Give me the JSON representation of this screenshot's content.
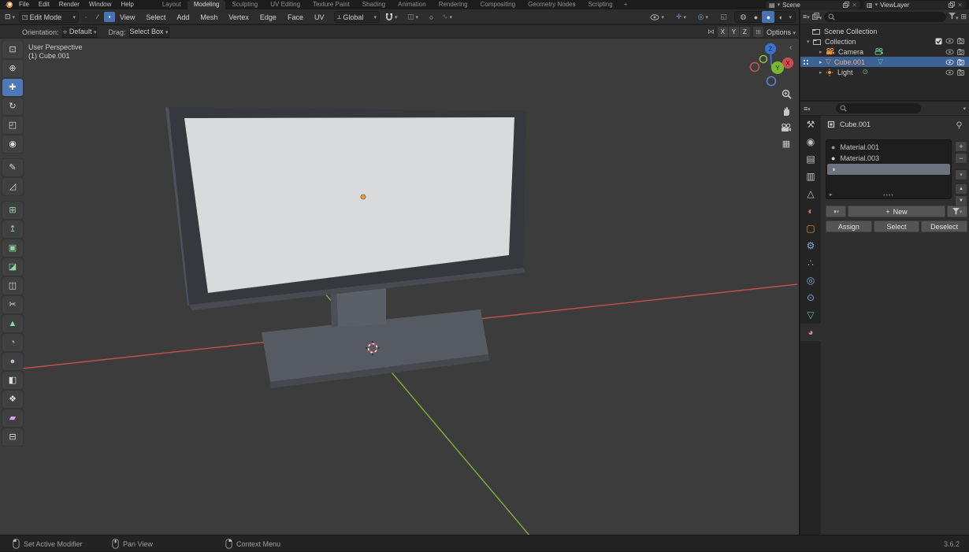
{
  "colors": {
    "selection_blue": "#4772b3",
    "active_object_text": "#f0ad6d",
    "axis_x_red": "#c0504f",
    "axis_y_green": "#7fb439",
    "gizmo_x": "#d04a55",
    "gizmo_y": "#7ab82f",
    "gizmo_z": "#3873cf",
    "screen_light": "#d9dadc",
    "origin_orange": "#ea9e43",
    "icon_green": "#63c184",
    "icon_orange": "#e8913c"
  },
  "topbar": {
    "menus": [
      {
        "name": "file",
        "label": "File"
      },
      {
        "name": "edit",
        "label": "Edit"
      },
      {
        "name": "render",
        "label": "Render"
      },
      {
        "name": "window",
        "label": "Window"
      },
      {
        "name": "help",
        "label": "Help"
      }
    ],
    "tabs": [
      {
        "name": "layout",
        "label": "Layout"
      },
      {
        "name": "modeling",
        "label": "Modeling",
        "active": true
      },
      {
        "name": "sculpting",
        "label": "Sculpting"
      },
      {
        "name": "uv-editing",
        "label": "UV Editing"
      },
      {
        "name": "texture-paint",
        "label": "Texture Paint"
      },
      {
        "name": "shading",
        "label": "Shading"
      },
      {
        "name": "animation",
        "label": "Animation"
      },
      {
        "name": "rendering",
        "label": "Rendering"
      },
      {
        "name": "compositing",
        "label": "Compositing"
      },
      {
        "name": "geometry-nodes",
        "label": "Geometry Nodes"
      },
      {
        "name": "scripting",
        "label": "Scripting"
      }
    ],
    "add_tab": "+",
    "scene_label": "Scene",
    "view_layer_label": "ViewLayer"
  },
  "viewport_header": {
    "mode": "Edit Mode",
    "menus": [
      {
        "name": "view",
        "label": "View"
      },
      {
        "name": "select",
        "label": "Select"
      },
      {
        "name": "add",
        "label": "Add"
      },
      {
        "name": "mesh",
        "label": "Mesh"
      },
      {
        "name": "vertex",
        "label": "Vertex"
      },
      {
        "name": "edge",
        "label": "Edge"
      },
      {
        "name": "face",
        "label": "Face"
      },
      {
        "name": "uv",
        "label": "UV"
      }
    ],
    "orientation": "Global"
  },
  "tool_settings": {
    "orientation_label": "Orientation:",
    "orientation_value": "Default",
    "drag_label": "Drag:",
    "drag_value": "Select Box",
    "axes": [
      {
        "name": "x",
        "label": "X"
      },
      {
        "name": "y",
        "label": "Y"
      },
      {
        "name": "z",
        "label": "Z"
      }
    ],
    "options_label": "Options"
  },
  "viewport": {
    "perspective_label": "User Perspective",
    "object_label": "(1) Cube.001",
    "gizmo": {
      "x": "X",
      "y": "Y",
      "z": "Z"
    }
  },
  "tools": [
    {
      "name": "select-box",
      "glyph": "⊡",
      "color": "#dcdcdc"
    },
    {
      "name": "cursor",
      "glyph": "⊕",
      "color": "#dcdcdc"
    },
    {
      "name": "move",
      "glyph": "✚",
      "color": "#f0f4fa",
      "active": true
    },
    {
      "name": "rotate",
      "glyph": "↻",
      "color": "#dcdcdc"
    },
    {
      "name": "scale",
      "glyph": "◰",
      "color": "#dcdcdc"
    },
    {
      "name": "transform",
      "glyph": "◉",
      "color": "#dcdcdc",
      "gap_after": true
    },
    {
      "name": "annotate",
      "glyph": "✎",
      "color": "#dcdcdc"
    },
    {
      "name": "measure",
      "glyph": "◿",
      "color": "#dcdcdc",
      "gap_after": true
    },
    {
      "name": "add-cube",
      "glyph": "⊞",
      "color": "#8fd6a4"
    },
    {
      "name": "extrude-region",
      "glyph": "↥",
      "color": "#8fd6a4"
    },
    {
      "name": "inset-faces",
      "glyph": "▣",
      "color": "#8fd6a4"
    },
    {
      "name": "bevel",
      "glyph": "◪",
      "color": "#8fd6a4"
    },
    {
      "name": "loop-cut",
      "glyph": "◫",
      "color": "#dcdcdc"
    },
    {
      "name": "knife",
      "glyph": "✂",
      "color": "#dcdcdc"
    },
    {
      "name": "poly-build",
      "glyph": "▲",
      "color": "#8fd6a4"
    },
    {
      "name": "spin",
      "glyph": "◔",
      "color": "#8fd6a4"
    },
    {
      "name": "smooth",
      "glyph": "●",
      "color": "#cbaade"
    },
    {
      "name": "edge-slide",
      "glyph": "◧",
      "color": "#dcdcdc"
    },
    {
      "name": "shrink-fatten",
      "glyph": "❖",
      "color": "#dcdcdc"
    },
    {
      "name": "shear",
      "glyph": "▰",
      "color": "#cbaade"
    },
    {
      "name": "rip-region",
      "glyph": "⊟",
      "color": "#dcdcdc"
    }
  ],
  "outliner": {
    "rows": [
      {
        "name": "scene-collection",
        "label": "Scene Collection"
      },
      {
        "name": "collection",
        "label": "Collection"
      },
      {
        "name": "camera",
        "label": "Camera"
      },
      {
        "name": "cube-001",
        "label": "Cube.001",
        "active": true
      },
      {
        "name": "light",
        "label": "Light"
      }
    ]
  },
  "properties": {
    "tabs": [
      {
        "name": "tool",
        "glyph": "⚒",
        "color": "#c2c2c2"
      },
      {
        "name": "render",
        "glyph": "◉",
        "color": "#c2c2c2"
      },
      {
        "name": "output",
        "glyph": "▤",
        "color": "#c2c2c2"
      },
      {
        "name": "view-layer",
        "glyph": "▥",
        "color": "#c2c2c2"
      },
      {
        "name": "scene",
        "glyph": "△",
        "color": "#c2c2c2"
      },
      {
        "name": "world",
        "glyph": "◐",
        "color": "#d2736b"
      },
      {
        "name": "object",
        "glyph": "▢",
        "color": "#e8913c"
      },
      {
        "name": "modifiers",
        "glyph": "⚙",
        "color": "#82aede"
      },
      {
        "name": "particles",
        "glyph": "∴",
        "color": "#82aede"
      },
      {
        "name": "physics",
        "glyph": "◎",
        "color": "#82aede"
      },
      {
        "name": "constraints",
        "glyph": "⊙",
        "color": "#82aede"
      },
      {
        "name": "object-data",
        "glyph": "▽",
        "color": "#63c184"
      },
      {
        "name": "material",
        "glyph": "◕",
        "color": "#df7f92",
        "active": true
      }
    ],
    "breadcrumb": "Cube.001",
    "slots": [
      {
        "label": "Material.001",
        "icon_color": "#9a9a9a"
      },
      {
        "label": "Material.003",
        "icon_color": "#d8d8d8"
      },
      {
        "label": "",
        "selected": true
      }
    ],
    "new_label": "New",
    "assign_label": "Assign",
    "select_label": "Select",
    "deselect_label": "Deselect"
  },
  "status_bar": {
    "hints": [
      {
        "name": "left-mouse",
        "label": "Set Active Modifier"
      },
      {
        "name": "middle-mouse",
        "label": "Pan View"
      },
      {
        "name": "right-mouse",
        "label": "Context Menu"
      }
    ],
    "version": "3.6.2"
  }
}
